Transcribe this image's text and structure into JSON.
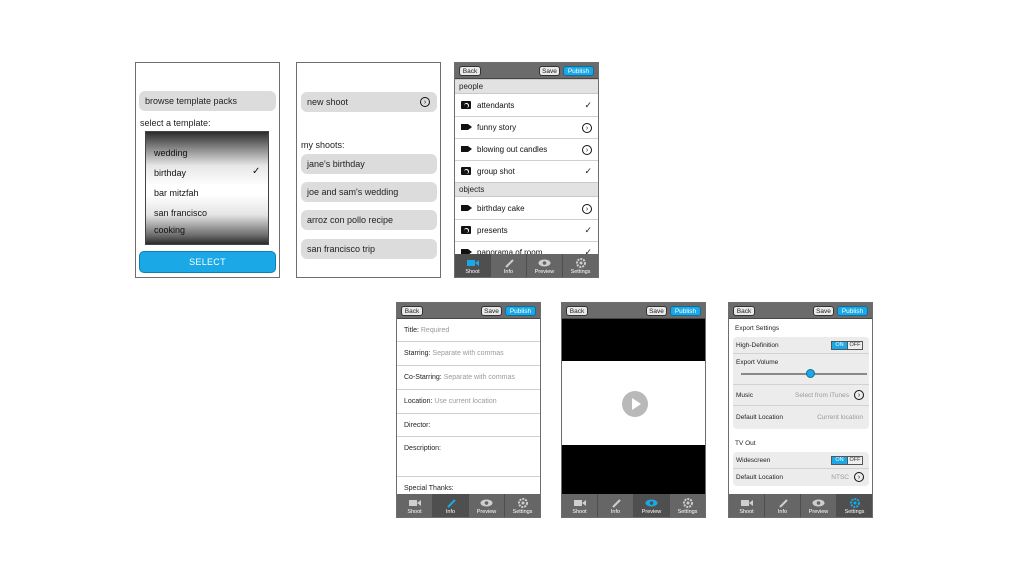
{
  "screen_templates": {
    "browse_label": "browse template packs",
    "select_label": "select a template:",
    "options": [
      "wedding",
      "birthday",
      "bar mitzfah",
      "san francisco",
      "cooking"
    ],
    "selected": "birthday",
    "select_button": "SELECT"
  },
  "screen_shoots": {
    "new_shoot": "new shoot",
    "my_shoots_label": "my shoots:",
    "shoots": [
      "jane's birthday",
      "joe and sam's wedding",
      "arroz con pollo recipe",
      "san francisco trip"
    ]
  },
  "nav": {
    "back": "Back",
    "save": "Save",
    "publish": "Publish"
  },
  "tabs": [
    "Shoot",
    "Info",
    "Preview",
    "Settings"
  ],
  "screen_shotlist": {
    "sections": [
      {
        "title": "people",
        "items": [
          {
            "label": "attendants",
            "kind": "photo",
            "status": "check"
          },
          {
            "label": "funny story",
            "kind": "video",
            "status": "arrow"
          },
          {
            "label": "blowing out candles",
            "kind": "video",
            "status": "arrow"
          },
          {
            "label": "group shot",
            "kind": "photo",
            "status": "check"
          }
        ]
      },
      {
        "title": "objects",
        "items": [
          {
            "label": "birthday cake",
            "kind": "video",
            "status": "arrow"
          },
          {
            "label": "presents",
            "kind": "photo",
            "status": "check"
          },
          {
            "label": "panorama of room",
            "kind": "video",
            "status": "check"
          }
        ]
      }
    ]
  },
  "screen_info": {
    "fields": [
      {
        "label": "Title:",
        "placeholder": "Required"
      },
      {
        "label": "Starring:",
        "placeholder": "Separate with commas"
      },
      {
        "label": "Co-Starring:",
        "placeholder": "Separate with commas"
      },
      {
        "label": "Location:",
        "placeholder": "Use current location"
      },
      {
        "label": "Director:",
        "placeholder": ""
      },
      {
        "label": "Description:",
        "placeholder": ""
      },
      {
        "label": "Special Thanks:",
        "placeholder": ""
      }
    ]
  },
  "screen_settings": {
    "export_header": "Export Settings",
    "hd_label": "High-Definition",
    "on": "ON",
    "off": "OFF",
    "volume_label": "Export Volume",
    "volume_level": 0.55,
    "music_label": "Music",
    "music_value": "Select from iTunes",
    "default_location_label": "Default Location",
    "default_location_value": "Current location",
    "tv_header": "TV Out",
    "widescreen_label": "Widescreen",
    "tv_default_location_label": "Default Location",
    "tv_default_location_value": "NTSC"
  },
  "icons": {
    "check": "✓",
    "arrow": "›"
  },
  "colors": {
    "accent": "#1aa8e6",
    "toolbar": "#6b6b6b",
    "tabbar": "#666666"
  }
}
